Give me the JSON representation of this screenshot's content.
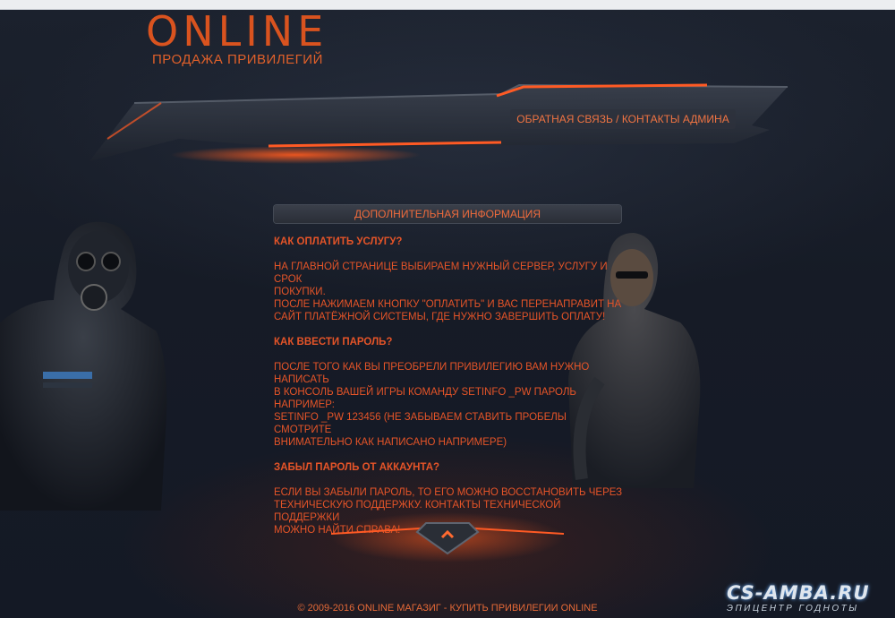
{
  "header": {
    "logo_title": "ONLINE",
    "logo_subtitle": "ПРОДАЖА ПРИВИЛЕГИЙ",
    "nav_link": "ОБРАТНАЯ СВЯЗЬ / КОНТАКТЫ АДМИНА"
  },
  "panel": {
    "heading": "ДОПОЛНИТЕЛЬНАЯ ИНФОРМАЦИЯ",
    "sections": [
      {
        "question": "КАК ОПЛАТИТЬ УСЛУГУ?",
        "lines": [
          "НА ГЛАВНОЙ СТРАНИЦЕ ВЫБИРАЕМ НУЖНЫЙ СЕРВЕР, УСЛУГУ И СРОК",
          "ПОКУПКИ.",
          "ПОСЛЕ НАЖИМАЕМ КНОПКУ \"ОПЛАТИТЬ\" И ВАС ПЕРЕНАПРАВИТ НА",
          "САЙТ ПЛАТЁЖНОЙ СИСТЕМЫ, ГДЕ НУЖНО ЗАВЕРШИТЬ ОПЛАТУ!"
        ]
      },
      {
        "question": "КАК ВВЕСТИ ПАРОЛЬ?",
        "lines": [
          "ПОСЛЕ ТОГО КАК ВЫ ПРЕОБРЕЛИ ПРИВИЛЕГИЮ ВАМ НУЖНО НАПИСАТЬ",
          "В КОНСОЛЬ ВАШЕЙ ИГРЫ КОМАНДУ SETINFO _PW ПАРОЛЬ НАПРИМЕР:",
          "SETINFO _PW 123456 (НЕ ЗАБЫВАЕМ СТАВИТЬ ПРОБЕЛЫ СМОТРИТЕ",
          "ВНИМАТЕЛЬНО КАК НАПИСАНО НАПРИМЕРЕ)"
        ]
      },
      {
        "question": "ЗАБЫЛ ПАРОЛЬ ОТ АККАУНТА?",
        "lines": [
          "ЕСЛИ ВЫ ЗАБЫЛИ ПАРОЛЬ, ТО ЕГО МОЖНО ВОССТАНОВИТЬ ЧЕРЕЗ",
          "ТЕХНИЧЕСКУЮ ПОДДЕРЖКУ. КОНТАКТЫ ТЕХНИЧЕСКОЙ ПОДДЕРЖКИ",
          "МОЖНО НАЙТИ СПРАВА!"
        ]
      }
    ]
  },
  "footer": {
    "copyright": "© 2009-2016 ONLINE МАГАЗИГ - КУПИТЬ ПРИВИЛЕГИИ ONLINE"
  },
  "watermark": {
    "title": "CS-AMBA.RU",
    "subtitle": "ЭПИЦЕНТР ГОДНОТЫ"
  },
  "colors": {
    "accent": "#e55428",
    "background": "#161b26"
  }
}
